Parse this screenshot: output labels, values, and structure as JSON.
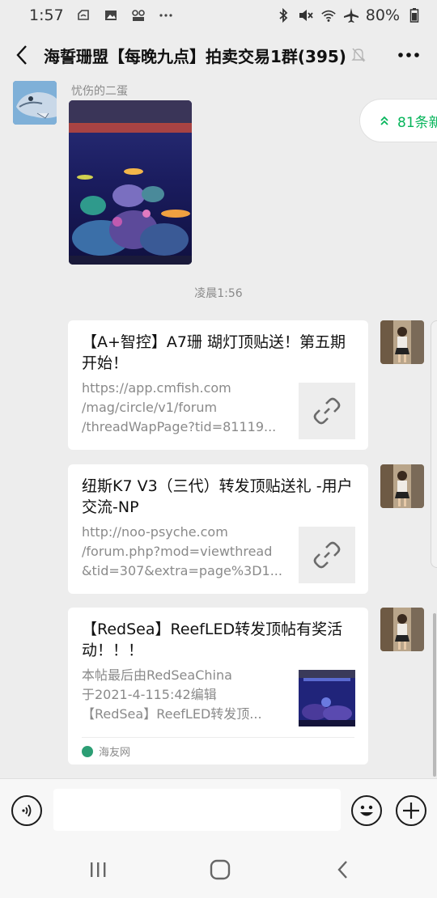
{
  "status_bar": {
    "time": "1:57",
    "battery": "80%",
    "left_icons": [
      "cloud-box-icon",
      "image-icon",
      "link-app-icon",
      "more-dots-icon"
    ],
    "right_icons": [
      "bluetooth-icon",
      "vibrate-mute-icon",
      "wifi-icon",
      "airplane-icon",
      "battery-icon"
    ]
  },
  "header": {
    "title": "海誓珊盟【每晚九点】拍卖交易1群(395)",
    "muted": true
  },
  "new_messages": {
    "label": "81条新"
  },
  "messages": {
    "first": {
      "sender": "忧伤的二蛋",
      "type": "image"
    },
    "time_divider": "凌晨1:56",
    "cards": [
      {
        "title": "【A+智控】A7珊 瑚灯顶贴送！第五期开始！",
        "desc": [
          "https://app.cmfish.com",
          "/mag/circle/v1/forum",
          "/threadWapPage?tid=81119..."
        ],
        "thumb": "link-icon"
      },
      {
        "title": "纽斯K7 V3（三代）转发顶贴送礼 -用户交流-NP",
        "desc": [
          "http://noo-psyche.com",
          "/forum.php?mod=viewthread",
          "&tid=307&extra=page%3D1..."
        ],
        "thumb": "link-icon"
      },
      {
        "title": "【RedSea】ReefLED转发顶帖有奖活动！！！",
        "desc": [
          "本帖最后由RedSeaChina",
          "于2021-4-115:42编辑",
          "【RedSea】ReefLED转发顶..."
        ],
        "thumb": "aquarium-photo",
        "source": "海友网"
      }
    ]
  },
  "input_bar": {
    "value": "",
    "buttons": [
      "voice-icon",
      "emoji-icon",
      "plus-icon"
    ]
  },
  "colors": {
    "background": "#ededed",
    "accent_green": "#07b55b",
    "secondary_text": "#8a8a8a"
  }
}
